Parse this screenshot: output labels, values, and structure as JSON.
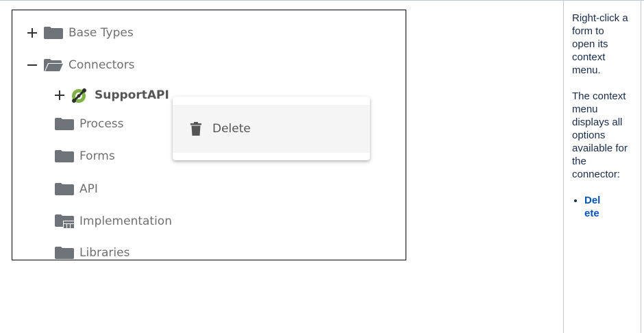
{
  "tree": {
    "items": [
      {
        "label": "Base Types",
        "expander": "plus",
        "icon": "folder-closed-icon"
      },
      {
        "label": "Connectors",
        "expander": "minus",
        "icon": "folder-open-icon"
      },
      {
        "label": "SupportAPI",
        "expander": "plus",
        "icon": "connector-icon"
      },
      {
        "label": "Process",
        "expander": "none",
        "icon": "folder-closed-icon"
      },
      {
        "label": "Forms",
        "expander": "none",
        "icon": "folder-closed-icon"
      },
      {
        "label": "API",
        "expander": "none",
        "icon": "folder-closed-icon"
      },
      {
        "label": "Implementation",
        "expander": "none",
        "icon": "folder-implementation-icon"
      },
      {
        "label": "Libraries",
        "expander": "none",
        "icon": "folder-closed-icon"
      }
    ]
  },
  "context_menu": {
    "items": [
      {
        "label": "Delete",
        "icon": "trash-icon"
      }
    ]
  },
  "side": {
    "para1": "Right-click a form to open its context menu.",
    "para2": "The context menu displays all options available for the connector:",
    "list": [
      "Delete"
    ]
  },
  "colors": {
    "folder": "#6d7379",
    "connector_green": "#7cb342",
    "link": "#0052cc"
  }
}
